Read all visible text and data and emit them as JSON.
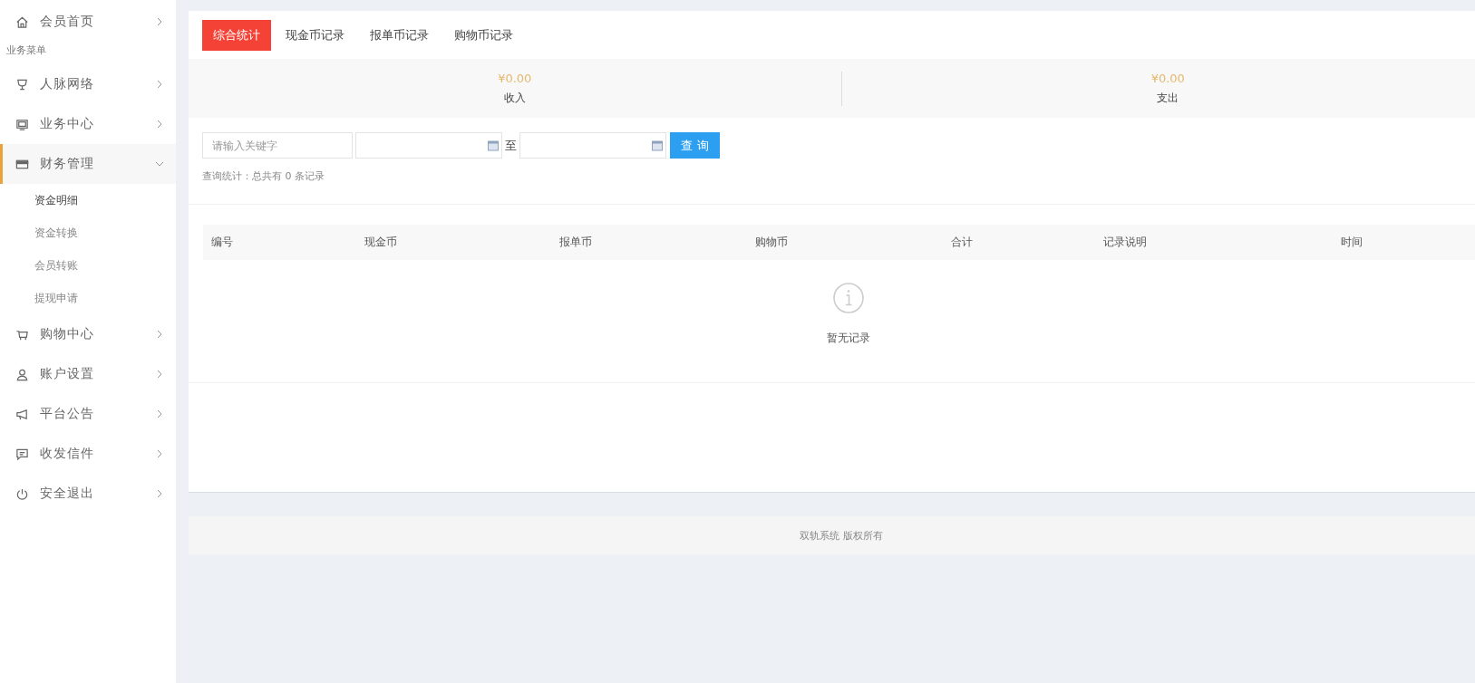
{
  "sidebar": {
    "items": [
      {
        "kind": "item",
        "label": "会员首页",
        "expanded": false,
        "selected": false
      },
      {
        "kind": "section",
        "label": "业务菜单"
      },
      {
        "kind": "item",
        "label": "人脉网络",
        "expanded": false,
        "selected": false
      },
      {
        "kind": "item",
        "label": "业务中心",
        "expanded": false,
        "selected": false
      },
      {
        "kind": "item",
        "label": "财务管理",
        "expanded": true,
        "selected": true,
        "children": [
          {
            "label": "资金明细",
            "selected": true
          },
          {
            "label": "资金转换",
            "selected": false
          },
          {
            "label": "会员转账",
            "selected": false
          },
          {
            "label": "提现申请",
            "selected": false
          }
        ]
      },
      {
        "kind": "item",
        "label": "购物中心",
        "expanded": false,
        "selected": false
      },
      {
        "kind": "item",
        "label": "账户设置",
        "expanded": false,
        "selected": false
      },
      {
        "kind": "item",
        "label": "平台公告",
        "expanded": false,
        "selected": false
      },
      {
        "kind": "item",
        "label": "收发信件",
        "expanded": false,
        "selected": false
      },
      {
        "kind": "item",
        "label": "安全退出",
        "expanded": false,
        "selected": false
      }
    ]
  },
  "tabs": [
    {
      "label": "综合统计",
      "selected": true
    },
    {
      "label": "现金币记录",
      "selected": false
    },
    {
      "label": "报单币记录",
      "selected": false
    },
    {
      "label": "购物币记录",
      "selected": false
    }
  ],
  "stats": [
    {
      "amount": "¥0.00",
      "label": "收入"
    },
    {
      "amount": "¥0.00",
      "label": "支出"
    }
  ],
  "filter": {
    "keyword_placeholder": "请输入关键字",
    "range_separator": "至",
    "search_button": "查 询"
  },
  "summary": "查询统计：总共有 0 条记录",
  "table": {
    "columns": [
      "编号",
      "现金币",
      "报单币",
      "购物币",
      "合计",
      "记录说明",
      "时间"
    ],
    "empty_text": "暂无记录"
  },
  "footer": "双轨系统 版权所有"
}
